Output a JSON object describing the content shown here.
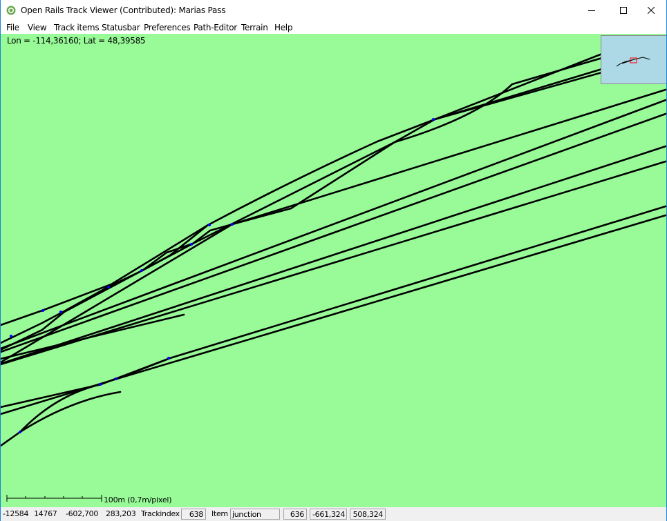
{
  "window": {
    "title": "Open Rails Track Viewer (Contributed): Marias Pass",
    "app_icon": "open-rails-icon",
    "controls": [
      "minimize-icon",
      "maximize-icon",
      "close-icon"
    ]
  },
  "menu": {
    "items": [
      "File",
      "View",
      "Track items",
      "Statusbar",
      "Preferences",
      "Path-Editor",
      "Terrain",
      "Help"
    ]
  },
  "map": {
    "coordinates": "Lon = -114,36160; Lat = 48,39585",
    "scale_label": "100m (0,7m/pixel)",
    "background_color": "#98fb98",
    "track_color": "#000000",
    "junction_color": "#0000ff",
    "minimap_color": "#add8e6",
    "minimap_marker_color": "#ff0000"
  },
  "statusbar": {
    "tile_x": "-12584",
    "tile_z": "14767",
    "world_x": "-602,700",
    "world_z": "283,203",
    "trackindex_label": "Trackindex",
    "trackindex_value": "638",
    "item_label": "Item",
    "item_value": "junction",
    "item_index": "636",
    "item_x": "-661,324",
    "item_z": "508,324"
  }
}
